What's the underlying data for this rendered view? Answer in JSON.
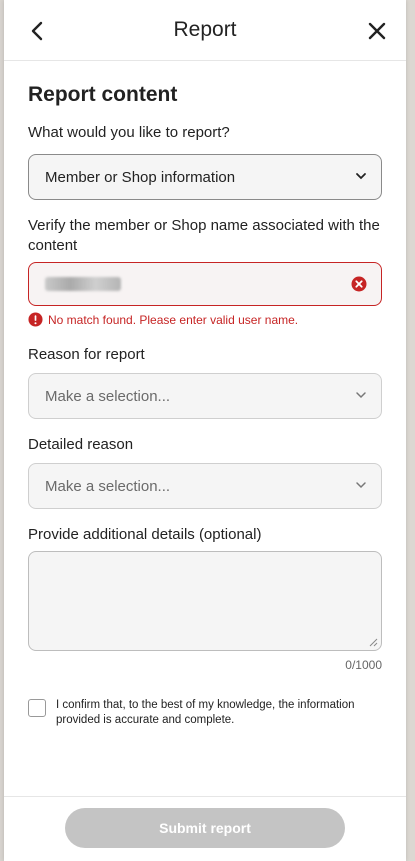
{
  "header": {
    "title": "Report"
  },
  "form": {
    "section_title": "Report content",
    "report_type_label": "What would you like to report?",
    "report_type_value": "Member or Shop information",
    "verify_label": "Verify the member or Shop name associated with the content",
    "verify_error": "No match found. Please enter valid user name.",
    "reason_label": "Reason for report",
    "reason_placeholder": "Make a selection...",
    "detailed_label": "Detailed reason",
    "detailed_placeholder": "Make a selection...",
    "details_label": "Provide additional details (optional)",
    "details_counter": "0/1000",
    "confirm_text": "I confirm that, to the best of my knowledge, the information provided is accurate and complete."
  },
  "footer": {
    "submit_label": "Submit report"
  },
  "colors": {
    "error": "#c62424",
    "disabled_button": "#c4c4c4"
  },
  "icons": {
    "back": "chevron-left-icon",
    "close": "close-icon",
    "clear": "clear-circle-icon",
    "error": "error-icon",
    "dropdown": "chevron-down-icon"
  }
}
